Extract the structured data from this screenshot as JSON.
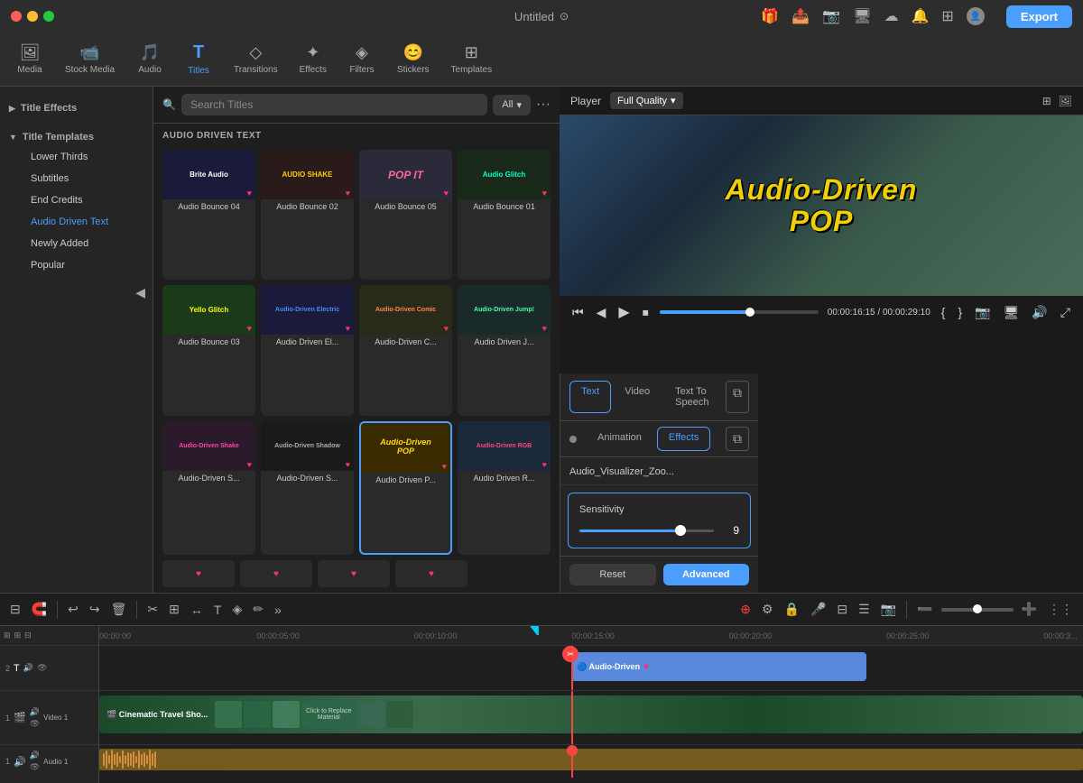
{
  "titlebar": {
    "title": "Untitled",
    "export_label": "Export"
  },
  "toolbar": {
    "items": [
      {
        "id": "media",
        "icon": "🖼",
        "label": "Media"
      },
      {
        "id": "stock",
        "icon": "📹",
        "label": "Stock Media"
      },
      {
        "id": "audio",
        "icon": "🎵",
        "label": "Audio"
      },
      {
        "id": "titles",
        "icon": "T",
        "label": "Titles",
        "active": true
      },
      {
        "id": "transitions",
        "icon": "◇",
        "label": "Transitions"
      },
      {
        "id": "effects",
        "icon": "✦",
        "label": "Effects"
      },
      {
        "id": "filters",
        "icon": "◈",
        "label": "Filters"
      },
      {
        "id": "stickers",
        "icon": "😊",
        "label": "Stickers"
      },
      {
        "id": "templates",
        "icon": "⊞",
        "label": "Templates"
      }
    ]
  },
  "left_panel": {
    "sections": [
      {
        "id": "title-effects",
        "label": "Title Effects",
        "collapsed": false
      },
      {
        "id": "title-templates",
        "label": "Title Templates",
        "collapsed": false,
        "items": [
          {
            "id": "lower-thirds",
            "label": "Lower Thirds",
            "active": false
          },
          {
            "id": "subtitles",
            "label": "Subtitles",
            "active": false
          },
          {
            "id": "end-credits",
            "label": "End Credits",
            "active": false
          },
          {
            "id": "audio-driven-text",
            "label": "Audio Driven Text",
            "active": true
          },
          {
            "id": "newly-added",
            "label": "Newly Added",
            "active": false
          },
          {
            "id": "popular",
            "label": "Popular",
            "active": false
          }
        ]
      }
    ]
  },
  "search": {
    "placeholder": "Search Titles",
    "filter_label": "All"
  },
  "titles_section": {
    "label": "AUDIO DRIVEN TEXT",
    "cards": [
      {
        "id": "bounce04",
        "label": "Audio Bounce 04",
        "bg": "#1a1a3a",
        "text": "Brite Audio",
        "text_color": "#ffffff",
        "selected": false
      },
      {
        "id": "shake",
        "label": "Audio Bounce 02",
        "bg": "#2a1a1a",
        "text": "AUDIO SHAKE",
        "text_color": "#ffcc00",
        "selected": false
      },
      {
        "id": "bounce05",
        "label": "Audio Bounce 05",
        "bg": "#2a2a2a",
        "text": "POP IT",
        "text_color": "#ff6699",
        "selected": false
      },
      {
        "id": "glitch",
        "label": "Audio Bounce 01",
        "bg": "#1a2a1a",
        "text": "Audio Glitch",
        "text_color": "#00ffcc",
        "selected": false
      },
      {
        "id": "bounce03",
        "label": "Audio Bounce 03",
        "bg": "#1a3a1a",
        "text": "Yello Glitch",
        "text_color": "#ffff00",
        "selected": false
      },
      {
        "id": "electric",
        "label": "Audio Driven El...",
        "bg": "#1a1a3a",
        "text": "Audio-Driven Electric",
        "text_color": "#4488ff",
        "selected": false
      },
      {
        "id": "comic",
        "label": "Audio-Driven C...",
        "bg": "#2a2a1a",
        "text": "Audio-Driven Comic",
        "text_color": "#ff8844",
        "selected": false
      },
      {
        "id": "jump",
        "label": "Audio Driven J...",
        "bg": "#1a2a2a",
        "text": "Audio-Driven Jump!",
        "text_color": "#44ffaa",
        "selected": false
      },
      {
        "id": "driven-shake",
        "label": "Audio-Driven S...",
        "bg": "#2a1a2a",
        "text": "Audio-Driven Shake",
        "text_color": "#ff44aa",
        "selected": false
      },
      {
        "id": "shadow",
        "label": "Audio-Driven S...",
        "bg": "#1a1a1a",
        "text": "Audio-Driven Shadow",
        "text_color": "#aaaaaa",
        "selected": false
      },
      {
        "id": "pop",
        "label": "Audio Driven P...",
        "bg": "#3a2a00",
        "text": "Audio-Driven POP",
        "text_color": "#ffdd00",
        "selected": true
      },
      {
        "id": "rgb",
        "label": "Audio Driven R...",
        "bg": "#1a2a3a",
        "text": "Audio-Driven RGB",
        "text_color": "#ff4488",
        "selected": false
      }
    ]
  },
  "player": {
    "label": "Player",
    "quality": "Full Quality",
    "time_current": "00:00:16:15",
    "time_total": "00:00:29:10",
    "preview_title_line1": "Audio-Driven",
    "preview_title_line2": "POP"
  },
  "effects_panel": {
    "tabs": [
      {
        "id": "text",
        "label": "Text",
        "active": true
      },
      {
        "id": "video",
        "label": "Video",
        "active": false
      },
      {
        "id": "text-to-speech",
        "label": "Text To Speech",
        "active": false
      }
    ],
    "sub_tabs": [
      {
        "id": "animation",
        "label": "Animation",
        "active": false
      },
      {
        "id": "effects",
        "label": "Effects",
        "active": true
      }
    ],
    "title": "Audio_Visualizer_Zoo...",
    "sensitivity": {
      "label": "Sensitivity",
      "value": 9,
      "percent": 75
    }
  },
  "timeline": {
    "time_markers": [
      "00:00:00",
      "00:00:05:00",
      "00:00:10:00",
      "00:00:15:00",
      "00:00:20:00",
      "00:00:25:00",
      "00:00:3..."
    ],
    "tracks": [
      {
        "id": "track-text",
        "num": "2",
        "icon": "T",
        "clip_label": "Audio-Driven",
        "clip_type": "audio"
      },
      {
        "id": "track-video1",
        "num": "1",
        "icon": "🎬",
        "label": "Video 1",
        "clip_label": "Cinematic Travel Sho...",
        "clip_type": "video"
      },
      {
        "id": "track-audio1",
        "num": "1",
        "icon": "🎵",
        "label": "Audio 1",
        "clip_type": "audio-wave"
      }
    ]
  },
  "buttons": {
    "reset": "Reset",
    "advanced": "Advanced"
  }
}
